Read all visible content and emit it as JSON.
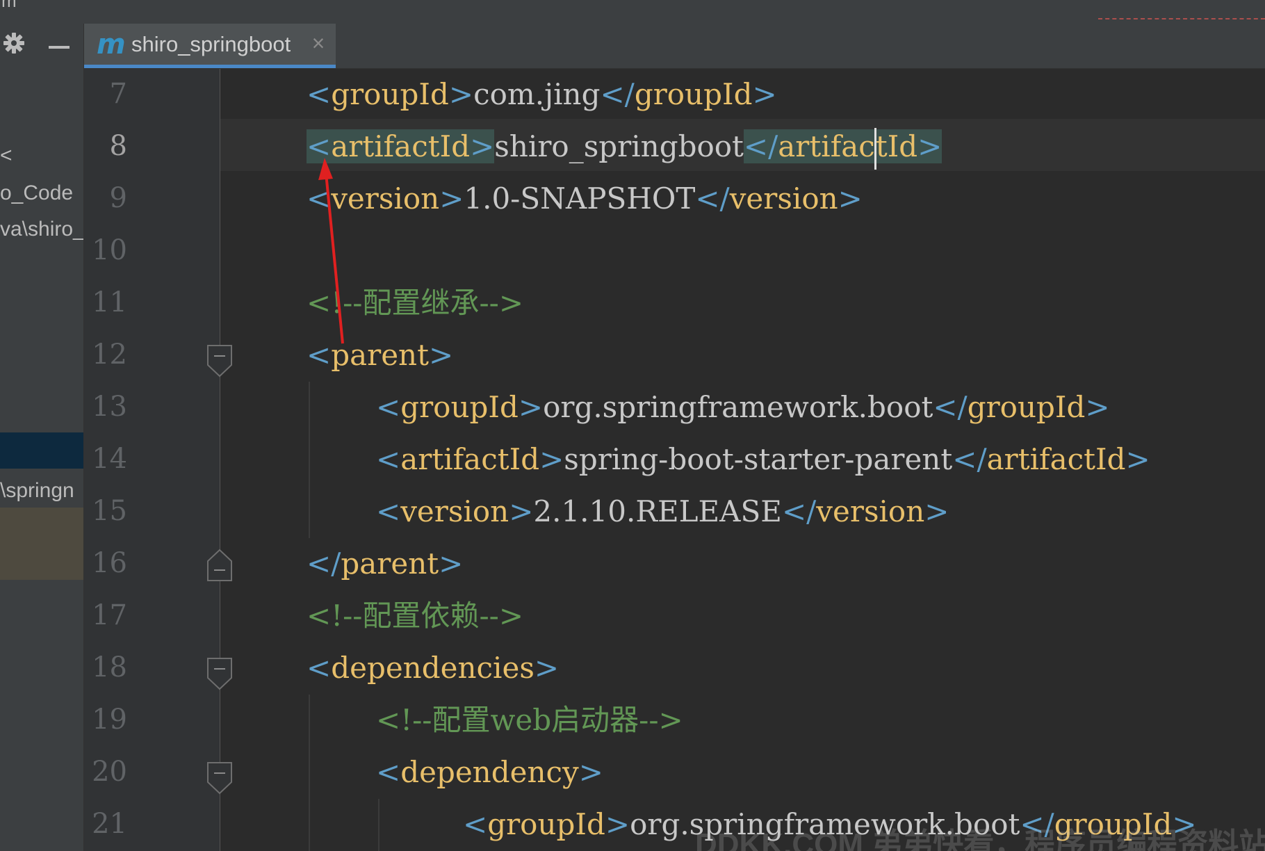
{
  "window": {
    "menu_fragment": "m"
  },
  "project_panel": {
    "icons": [
      "gear-icon",
      "minimize-icon"
    ],
    "rows": [
      {
        "label": "<"
      },
      {
        "label": "o_Code"
      },
      {
        "label": "va\\shiro_"
      },
      {
        "label": "\\springn"
      }
    ]
  },
  "tab": {
    "icon": "m",
    "label": "shiro_springboot",
    "close": "×"
  },
  "editor": {
    "current_line": 8,
    "lines": [
      {
        "n": "7"
      },
      {
        "n": "8"
      },
      {
        "n": "9"
      },
      {
        "n": "10"
      },
      {
        "n": "11"
      },
      {
        "n": "12"
      },
      {
        "n": "13"
      },
      {
        "n": "14"
      },
      {
        "n": "15"
      },
      {
        "n": "16"
      },
      {
        "n": "17"
      },
      {
        "n": "18"
      },
      {
        "n": "19"
      },
      {
        "n": "20"
      },
      {
        "n": "21"
      }
    ],
    "code": {
      "l7": {
        "open": "groupId",
        "value": "com.jing",
        "close": "groupId"
      },
      "l8": {
        "open": "artifactId",
        "value": "shiro_springboot",
        "close_a": "artifac",
        "close_b": "tId"
      },
      "l9": {
        "open": "version",
        "value": "1.0-SNAPSHOT",
        "close": "version"
      },
      "l11": {
        "comment": "<!--配置继承-->"
      },
      "l12": {
        "open": "parent"
      },
      "l13": {
        "open": "groupId",
        "value": "org.springframework.boot",
        "close": "groupId"
      },
      "l14": {
        "open": "artifactId",
        "value": "spring-boot-starter-parent",
        "close": "artifactId"
      },
      "l15": {
        "open": "version",
        "value": "2.1.10.RELEASE",
        "close": "version"
      },
      "l16": {
        "close": "parent"
      },
      "l17": {
        "comment": "<!--配置依赖-->"
      },
      "l18": {
        "open": "dependencies"
      },
      "l19": {
        "comment": "<!--配置web启动器-->"
      },
      "l20": {
        "open": "dependency"
      },
      "l21": {
        "open": "groupId",
        "value": "org.springframework.boot",
        "close": "groupId"
      }
    }
  },
  "watermark": "DDKK.COM 弟弟快看，程序员编程资料站",
  "colors": {
    "tag": "#e8bf6a",
    "bracket": "#5f9ec9",
    "text": "#c8c8c8",
    "comment": "#629755",
    "tab_underline": "#4a88c7",
    "annotation_arrow": "#e02020"
  }
}
